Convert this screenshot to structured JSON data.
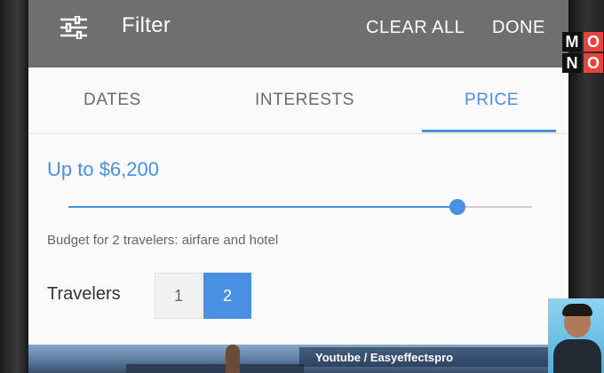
{
  "appbar": {
    "title": "Filter",
    "clear_all": "CLEAR ALL",
    "done": "DONE",
    "filter_icon": "sliders-icon"
  },
  "tabs": [
    {
      "label": "DATES",
      "active": false
    },
    {
      "label": "INTERESTS",
      "active": false
    },
    {
      "label": "PRICE",
      "active": true
    }
  ],
  "price": {
    "value_label": "Up to $6,200",
    "slider_fraction": 0.84,
    "note": "Budget for 2 travelers: airfare and hotel"
  },
  "travelers": {
    "label": "Travelers",
    "options": [
      "1",
      "2"
    ],
    "selected": "2"
  },
  "overlay": {
    "watermark": "Youtube / Easyeffectspro",
    "logo_letters": [
      "M",
      "O",
      "N",
      "O"
    ]
  },
  "colors": {
    "accent": "#4a90e2",
    "appbar": "#6f6f6f"
  }
}
